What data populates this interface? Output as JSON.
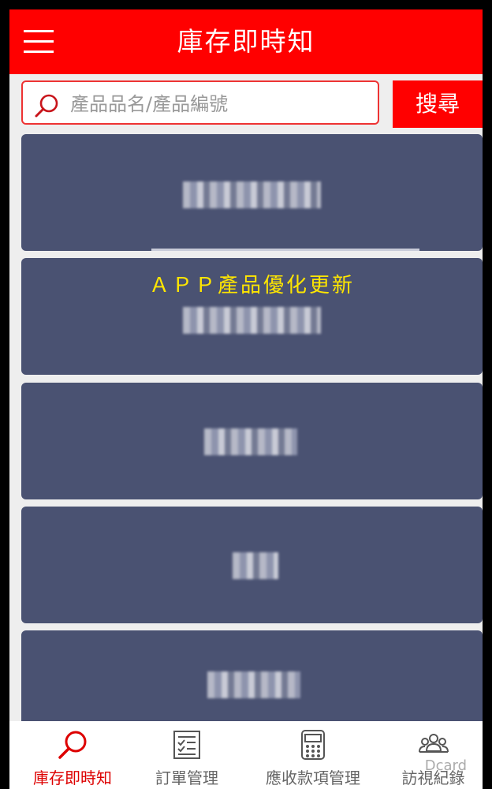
{
  "app_bar": {
    "title": "庫存即時知",
    "menu_icon": "hamburger-menu-icon"
  },
  "search": {
    "placeholder": "產品品名/產品編號",
    "value": "",
    "button_label": "搜尋",
    "icon": "search-icon"
  },
  "cards": [
    {
      "text": ""
    },
    {
      "text": "ＡＰＰ產品優化更新"
    },
    {
      "text": ""
    },
    {
      "text": ""
    },
    {
      "text": ""
    }
  ],
  "bottom_nav": [
    {
      "label": "庫存即時知",
      "icon": "search-icon",
      "active": true
    },
    {
      "label": "訂單管理",
      "icon": "checklist-icon",
      "active": false
    },
    {
      "label": "應收款項管理",
      "icon": "calculator-icon",
      "active": false
    },
    {
      "label": "訪視紀錄",
      "icon": "people-icon",
      "active": false
    }
  ],
  "watermark": "Dcard",
  "colors": {
    "brand_red": "#ff0000",
    "card_bg": "#4a5272",
    "highlight_text": "#ffe600",
    "active_nav": "#dd0000"
  }
}
